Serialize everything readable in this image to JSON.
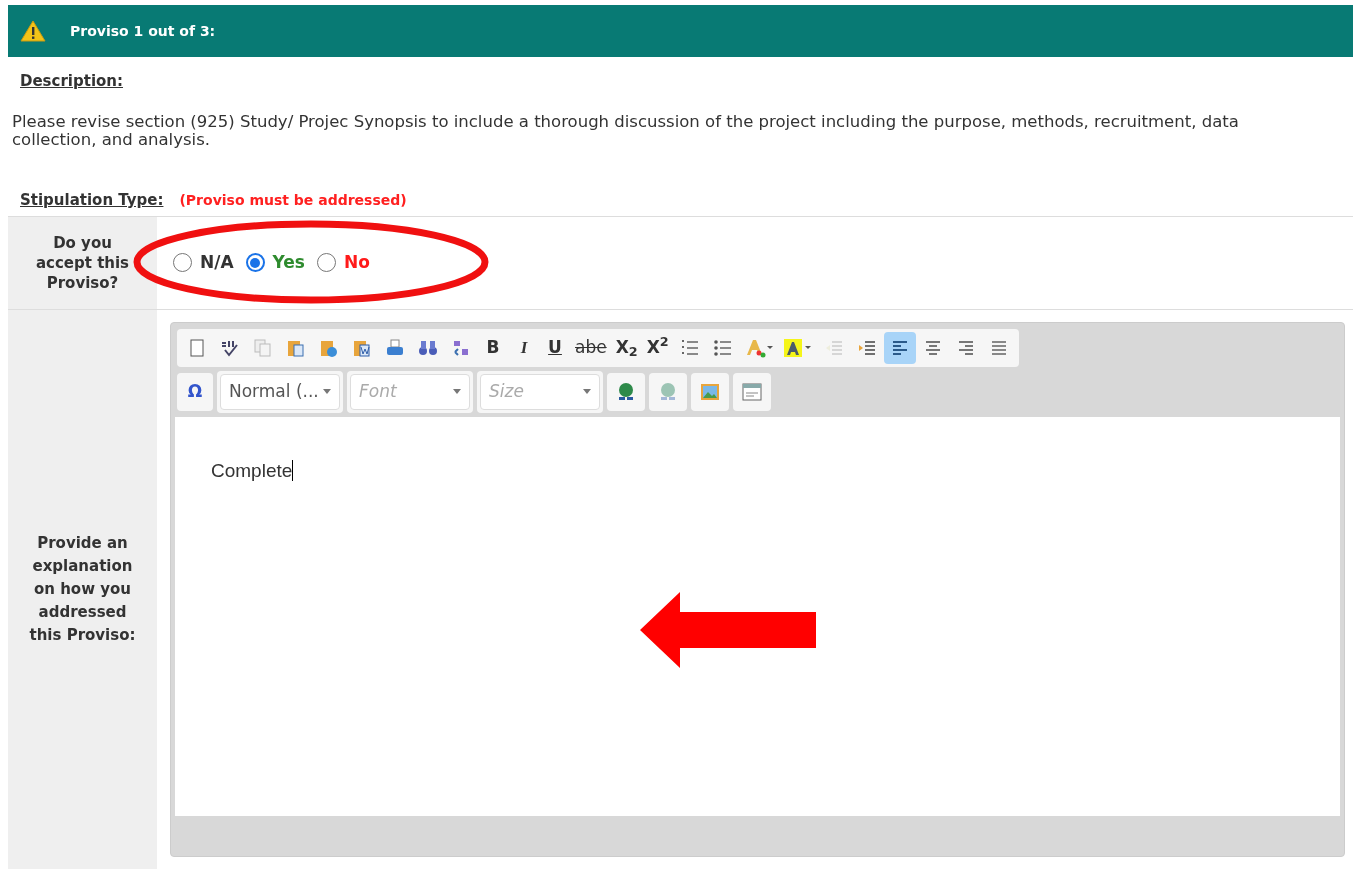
{
  "header": {
    "title": "Proviso 1 out of 3:"
  },
  "description": {
    "heading": "Description:",
    "text": "Please revise section (925) Study/ Projec Synopsis to include a thorough discussion of the project including the purpose, methods, recruitment, data collection, and analysis."
  },
  "stipulation": {
    "heading": "Stipulation Type:",
    "note": "(Proviso must be addressed)"
  },
  "accept_row": {
    "label": "Do you accept this Proviso?",
    "options": [
      {
        "label": "N/A",
        "selected": false,
        "color": "#333333"
      },
      {
        "label": "Yes",
        "selected": true,
        "color": "#2e8b2e"
      },
      {
        "label": "No",
        "selected": false,
        "color": "#ff1a1a"
      }
    ]
  },
  "explanation_row": {
    "label": "Provide an explanation on how you addressed this Proviso:",
    "toolbar_row_1": [
      {
        "kind": "new-page"
      },
      {
        "kind": "spellcheck"
      },
      {
        "kind": "copy"
      },
      {
        "kind": "paste"
      },
      {
        "kind": "paste-text"
      },
      {
        "kind": "paste-word"
      },
      {
        "kind": "print"
      },
      {
        "kind": "find"
      },
      {
        "kind": "replace"
      },
      {
        "kind": "bold",
        "label": "B"
      },
      {
        "kind": "italic",
        "label": "I"
      },
      {
        "kind": "underline",
        "label": "U"
      },
      {
        "kind": "strike",
        "label": "abe"
      },
      {
        "kind": "subscript",
        "label": "X$_{2}$"
      },
      {
        "kind": "superscript",
        "label": "X$^{2}$"
      },
      {
        "kind": "numbered-list"
      },
      {
        "kind": "bulleted-list"
      },
      {
        "kind": "text-color"
      },
      {
        "kind": "background-color"
      },
      {
        "kind": "outdent"
      },
      {
        "kind": "indent"
      },
      {
        "kind": "align-left",
        "selected": true
      },
      {
        "kind": "align-center",
        "selected": false
      },
      {
        "kind": "align-right",
        "selected": false
      },
      {
        "kind": "justify",
        "selected": false
      }
    ],
    "toolbar_row_2": [
      {
        "kind": "special-character",
        "label": "Ω"
      },
      {
        "kind": "dropdown",
        "label": "Normal (..."
      },
      {
        "kind": "empty-dropdown",
        "label": "Font"
      },
      {
        "kind": "empty-dropdown",
        "label": "Size"
      },
      {
        "kind": "link"
      },
      {
        "kind": "unlink"
      },
      {
        "kind": "image"
      },
      {
        "kind": "iframe"
      }
    ],
    "editor_text": "Complete"
  }
}
